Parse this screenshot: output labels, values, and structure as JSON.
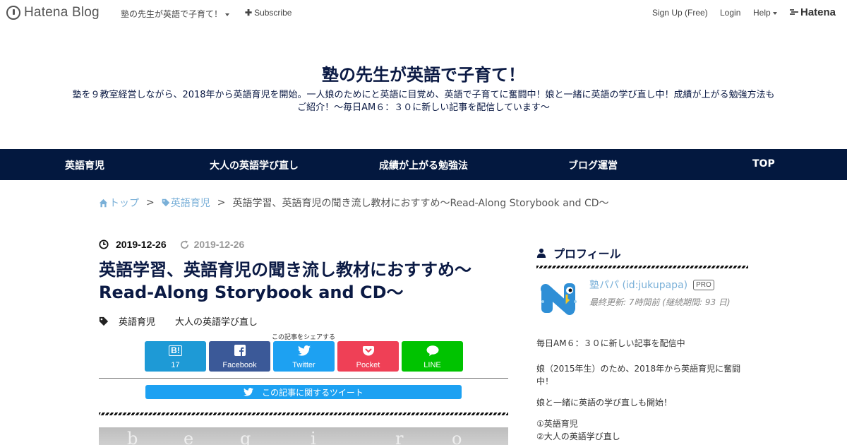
{
  "hatena_bar": {
    "logo_text": "Hatena Blog",
    "blog_title": "塾の先生が英語で子育て！",
    "subscribe": "Subscribe",
    "sign_up": "Sign Up (Free)",
    "login": "Login",
    "help": "Help",
    "hatena": "Hatena"
  },
  "header": {
    "title": "塾の先生が英語で子育て！",
    "description": "塾を９教室経営しながら、2018年から英語育児を開始。一人娘のためにと英語に目覚め、英語で子育てに奮闘中！娘と一緒に英語の学び直し中！成績が上がる勉強方法もご紹介！～毎日AM６：３０に新しい記事を配信しています～"
  },
  "nav": {
    "items": [
      {
        "label": "英語育児"
      },
      {
        "label": "大人の英語学び直し"
      },
      {
        "label": "成績が上がる勉強法"
      },
      {
        "label": "ブログ運営"
      },
      {
        "label": "TOP"
      }
    ]
  },
  "breadcrumb": {
    "home": "トップ",
    "category": "英語育児",
    "current": "英語学習、英語育児の聞き流し教材におすすめ～Read-Along Storybook and CD～",
    "separator": ">"
  },
  "article": {
    "published": "2019-12-26",
    "updated": "2019-12-26",
    "title": "英語学習、英語育児の聞き流し教材におすすめ～Read-Along Storybook and CD～",
    "categories": [
      "英語育児",
      "大人の英語学び直し"
    ],
    "share_caption": "この記事をシェアする",
    "share_buttons": [
      {
        "label": "17",
        "icon": "hatena-bookmark-icon",
        "color": "#1e9ad6"
      },
      {
        "label": "Facebook",
        "icon": "facebook-icon",
        "color": "#3b5998"
      },
      {
        "label": "Twitter",
        "icon": "twitter-icon",
        "color": "#1da1f2"
      },
      {
        "label": "Pocket",
        "icon": "pocket-icon",
        "color": "#ef4056"
      },
      {
        "label": "LINE",
        "icon": "line-icon",
        "color": "#00c300"
      }
    ],
    "tweet_button": "この記事に関するツイート"
  },
  "sidebar": {
    "profile_heading": "プロフィール",
    "user_name": "塾パパ (id:jukupapa)",
    "badge": "PRO",
    "meta": "最終更新: 7時間前 (継続期間: 93 日)",
    "para1": "毎日AM６：３０に新しい記事を配信中",
    "para2": "娘（2015年生）のため、2018年から英語育児に奮闘中！",
    "para3": "娘と一緒に英語の学び直しも開始！",
    "list": [
      "①英語育児",
      "②大人の英語学び直し"
    ]
  }
}
